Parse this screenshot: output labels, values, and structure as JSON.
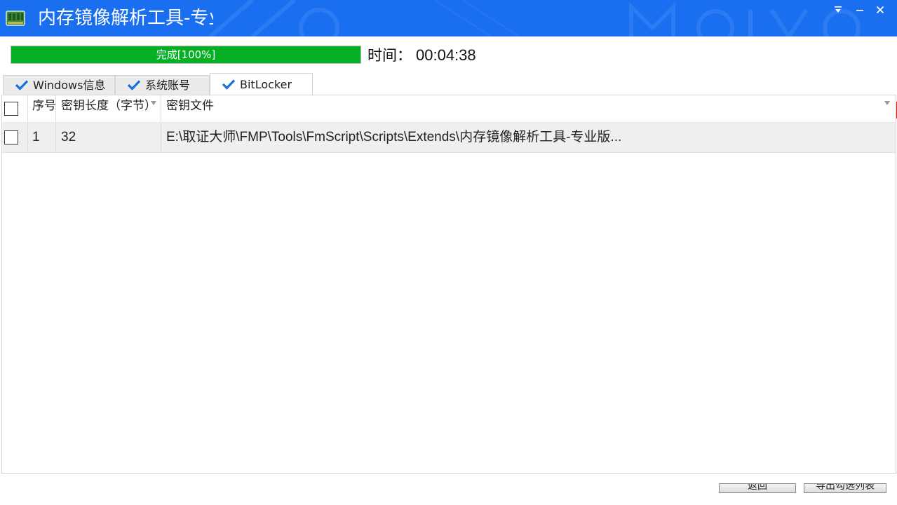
{
  "window": {
    "title": "内存镜像解析工具-专业版",
    "icons": {
      "app": "memory-chip-icon",
      "menu": "chevron-down-icon",
      "minimize": "minimize-icon",
      "close": "close-icon"
    },
    "colors": {
      "titlebar": "#1a6ff0",
      "progress": "#06b025",
      "check": "#1670e4"
    }
  },
  "progress": {
    "label": "完成[100%]",
    "percent": 100,
    "time_label": "时间：",
    "time_value": "00:04:38"
  },
  "tabs": [
    {
      "label": "Windows信息",
      "checked": true
    },
    {
      "label": "系统账号",
      "checked": true
    },
    {
      "label": "BitLocker",
      "checked": true,
      "active": true
    }
  ],
  "grid": {
    "columns": [
      "序号",
      "密钥长度（字节）",
      "密钥文件"
    ],
    "rows": [
      {
        "index": "1",
        "key_length": "32",
        "key_file": "E:\\取证大师\\FMP\\Tools\\FmScript\\Scripts\\Extends\\内存镜像解析工具-专业版..."
      }
    ]
  },
  "footer": {
    "back_label": "返回",
    "export_label": "导出勾选列表"
  }
}
